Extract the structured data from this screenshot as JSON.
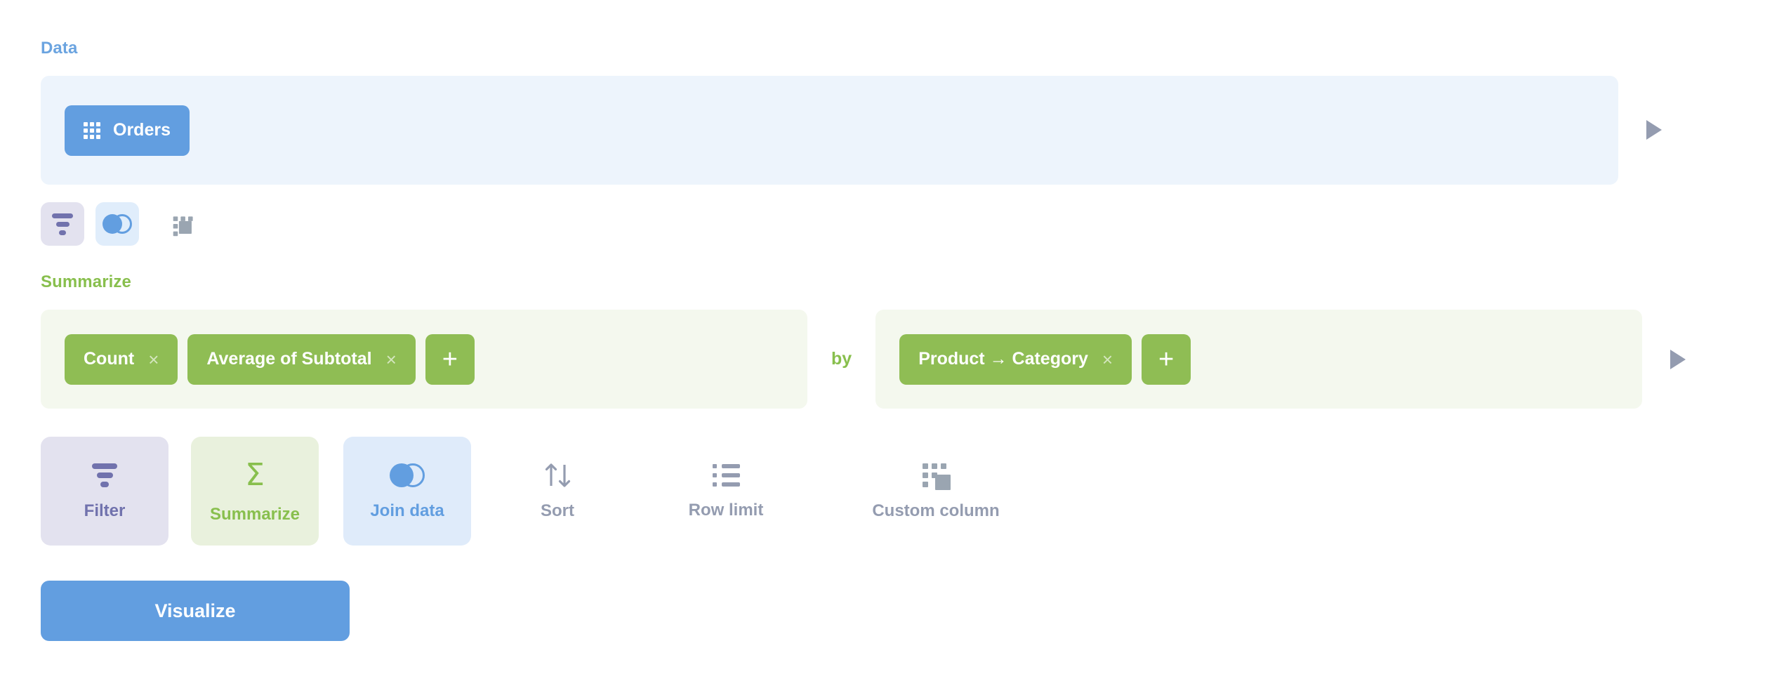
{
  "sections": {
    "data": {
      "label": "Data",
      "source_chip": {
        "name": "Orders",
        "icon": "table-grid-icon"
      },
      "run_arrow": "play-icon",
      "quick_actions": [
        {
          "id": "filter",
          "icon": "filter-funnel-icon",
          "state": "active-purple"
        },
        {
          "id": "join",
          "icon": "join-venn-icon",
          "state": "active-blue"
        },
        {
          "id": "custom-column",
          "icon": "custom-column-icon",
          "state": "plain"
        }
      ]
    },
    "summarize": {
      "label": "Summarize",
      "metrics": [
        {
          "name": "Count",
          "remove": "×"
        },
        {
          "name": "Average of Subtotal",
          "remove": "×"
        }
      ],
      "add_metric_label": "+",
      "by_label": "by",
      "breakouts": [
        {
          "name": "Product → Category",
          "remove": "×"
        }
      ],
      "add_breakout_label": "+",
      "run_arrow": "play-icon"
    }
  },
  "action_tiles": [
    {
      "id": "filter",
      "label": "Filter",
      "icon": "filter-funnel-icon"
    },
    {
      "id": "summarize",
      "label": "Summarize",
      "icon": "sigma-icon"
    },
    {
      "id": "join-data",
      "label": "Join data",
      "icon": "join-venn-icon"
    },
    {
      "id": "sort",
      "label": "Sort",
      "icon": "sort-arrows-icon"
    },
    {
      "id": "row-limit",
      "label": "Row limit",
      "icon": "list-icon"
    },
    {
      "id": "custom-column",
      "label": "Custom column",
      "icon": "custom-column-icon"
    }
  ],
  "visualize": {
    "label": "Visualize"
  },
  "colors": {
    "data_accent": "#629ee0",
    "summarize_accent": "#88bf4d",
    "filter_accent": "#7172ad",
    "muted": "#949cb0",
    "data_panel_bg": "#edf4fc",
    "summarize_panel_bg": "#f4f8ee"
  }
}
